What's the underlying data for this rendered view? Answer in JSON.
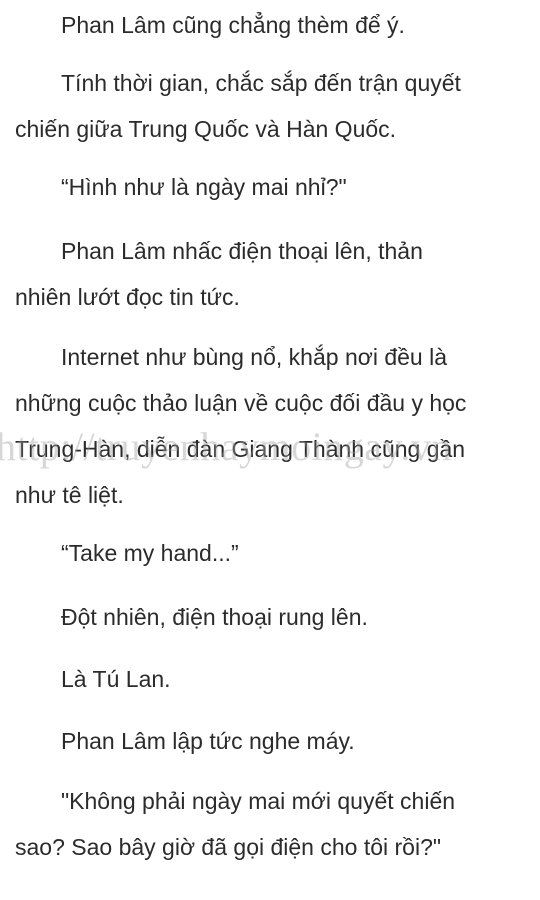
{
  "paragraphs": [
    "Phan Lâm cũng chẳng thèm để ý.",
    "Tính thời gian, chắc sắp đến trận quyết\nchiến giữa Trung Quốc và Hàn Quốc.",
    "“Hình như là ngày mai nhỉ?\"",
    "Phan Lâm nhấc điện thoại lên, thản\nnhiên lướt đọc tin tức.",
    "Internet như bùng nổ, khắp nơi đều là\nnhững cuộc thảo luận về cuộc đối đầu y học\nTrung-Hàn, diễn đàn Giang Thành cũng gần\nnhư tê liệt.",
    "“Take my hand...”",
    "Đột nhiên, điện thoại rung lên.",
    "Là Tú Lan.",
    "Phan Lâm lập tức nghe máy.",
    "\"Không phải ngày mai mới quyết chiến\nsao? Sao bây giờ đã gọi điện cho tôi rồi?\""
  ],
  "watermark": "http://truyenhaymoingay.vn"
}
